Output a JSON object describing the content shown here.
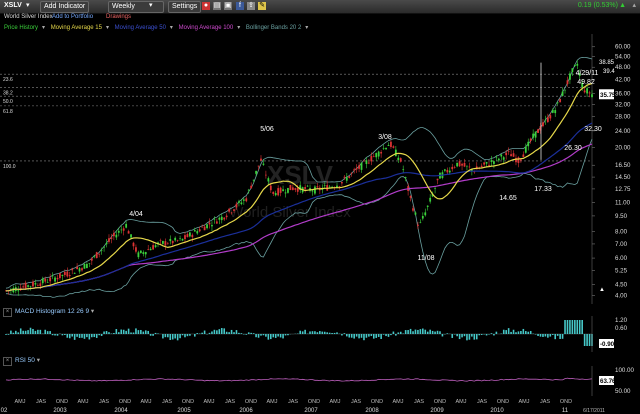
{
  "toolbar": {
    "symbol": "XSLV",
    "add_indicator": "Add Indicator",
    "period": "Weekly",
    "settings": "Settings",
    "last_change": "0.19 (0.53%)"
  },
  "subbar": {
    "name": "World Silver Index",
    "add_portfolio": "Add to Portfolio",
    "drawings": "Drawings"
  },
  "legend": {
    "price_history": "Price History",
    "ma15": "Moving Average 15",
    "ma50": "Moving Average 50",
    "ma100": "Moving Average 100",
    "bb": "Bollinger Bands 20 2"
  },
  "colors": {
    "price": "#3bd13b",
    "ma15": "#e6d84a",
    "ma50": "#1b2f9a",
    "ma100": "#b23cc9",
    "bb": "#6aa0a0",
    "macd": "#46c8c8",
    "rsi": "#c060c0"
  },
  "watermark": {
    "symbol": "XSLV",
    "name": "World Silver Index"
  },
  "main_chart": {
    "price_labels": [
      "38.85",
      "39.4"
    ],
    "last_price": "35.75",
    "y_ticks": [
      "60.00",
      "54.00",
      "48.00",
      "42.00",
      "36.00",
      "32.00",
      "28.00",
      "24.00",
      "20.00",
      "16.50",
      "14.50",
      "12.75",
      "11.00",
      "9.50",
      "8.00",
      "7.00",
      "6.00",
      "5.25",
      "4.50",
      "4.00"
    ],
    "fib_labels": [
      "23.6",
      "38.2",
      "50.0",
      "61.8",
      "100.0"
    ],
    "annotations": [
      "4/04",
      "5/06",
      "3/08",
      "11/08",
      "14.65",
      "17.33",
      "26.30",
      "4/29/11",
      "49.82",
      "32.30"
    ]
  },
  "macd": {
    "title": "MACD Histogram 12 26 9",
    "y_ticks": [
      "1.20",
      "0.60",
      "-0.90"
    ],
    "last": "-0.90"
  },
  "rsi": {
    "title": "RSI 50",
    "y_ticks": [
      "100.00",
      "50.00"
    ],
    "last": "63.76"
  },
  "x_axis": {
    "top_row": [
      "AMJ",
      "JAS",
      "OND",
      "AMJ",
      "JAS",
      "OND",
      "AMJ",
      "JAS",
      "OND",
      "AMJ",
      "JAS",
      "OND",
      "AMJ",
      "JAS",
      "OND",
      "AMJ",
      "JAS",
      "OND",
      "AMJ",
      "JAS",
      "OND",
      "AMJ",
      "JAS",
      "OND",
      "AMJ",
      "JAS",
      "OND"
    ],
    "years": [
      "02",
      "2003",
      "2004",
      "2005",
      "2006",
      "2007",
      "2008",
      "2009",
      "2010",
      "11"
    ],
    "date_stamp": "6/17/2011"
  }
}
